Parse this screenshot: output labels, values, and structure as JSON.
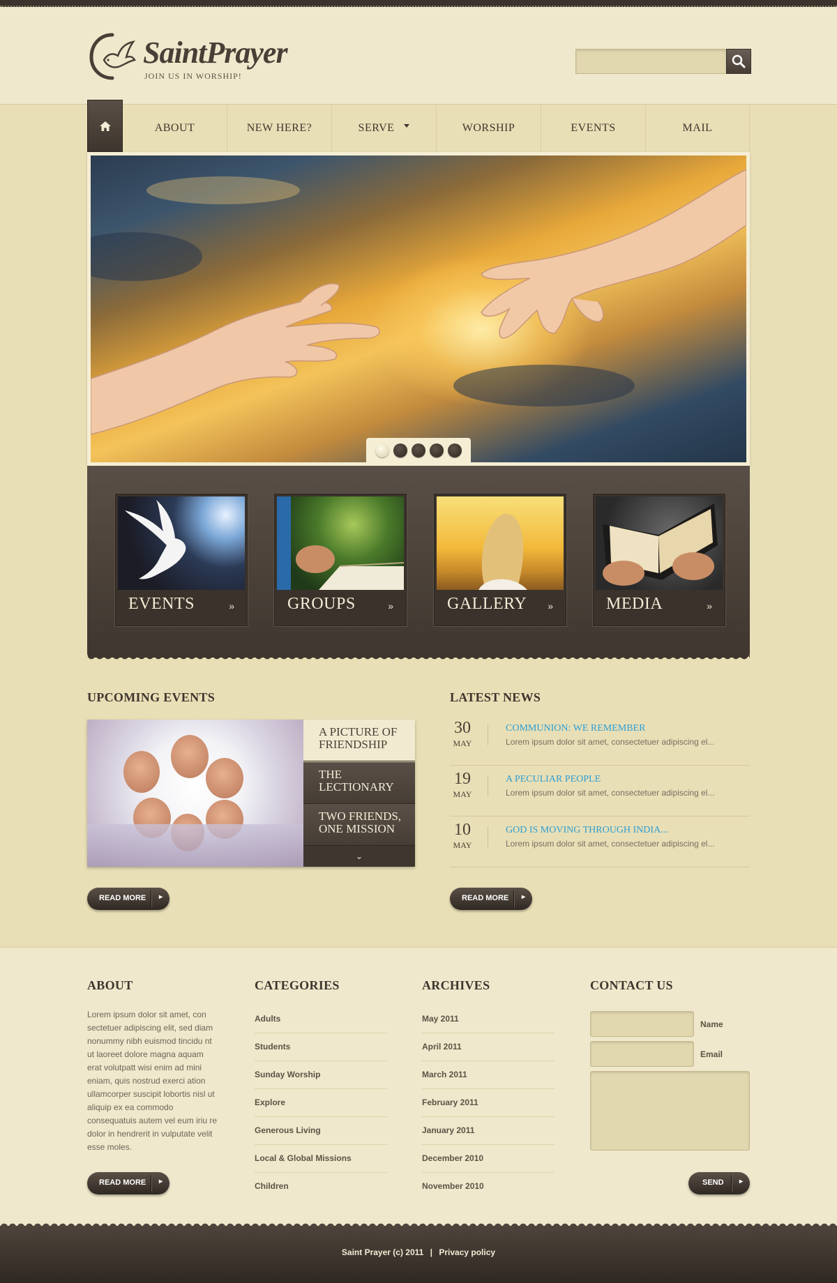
{
  "brand": {
    "name": "SaintPrayer",
    "tagline": "JOIN US IN WORSHIP!"
  },
  "search": {
    "value": "",
    "icon": "search-icon"
  },
  "nav": {
    "home_icon": "home-icon",
    "items": [
      {
        "label": "ABOUT"
      },
      {
        "label": "NEW HERE?"
      },
      {
        "label": "SERVE",
        "has_dropdown": true
      },
      {
        "label": "WORSHIP"
      },
      {
        "label": "EVENTS"
      },
      {
        "label": "MAIL"
      }
    ]
  },
  "slider": {
    "slide_count": 5,
    "active_index": 0
  },
  "features": [
    {
      "label": "EVENTS"
    },
    {
      "label": "GROUPS"
    },
    {
      "label": "GALLERY"
    },
    {
      "label": "MEDIA"
    }
  ],
  "upcoming": {
    "title": "UPCOMING EVENTS",
    "items": [
      {
        "title": "A PICTURE OF FRIENDSHIP",
        "line1": "A PICTURE OF",
        "line2": "FRIENDSHIP"
      },
      {
        "title": "THE LECTIONARY",
        "line1": "THE",
        "line2": "LECTIONARY"
      },
      {
        "title": "TWO FRIENDS, ONE MISSION",
        "line1": "TWO FRIENDS,",
        "line2": "ONE MISSION"
      }
    ],
    "read_more": "READ MORE"
  },
  "news": {
    "title": "LATEST NEWS",
    "items": [
      {
        "day": "30",
        "month": "MAY",
        "title": "COMMUNION: WE REMEMBER",
        "excerpt": "Lorem ipsum dolor sit amet, consectetuer adipiscing el..."
      },
      {
        "day": "19",
        "month": "MAY",
        "title": "A PECULIAR PEOPLE",
        "excerpt": "Lorem ipsum dolor sit amet, consectetuer adipiscing el..."
      },
      {
        "day": "10",
        "month": "MAY",
        "title": "GOD IS MOVING THROUGH INDIA...",
        "excerpt": "Lorem ipsum dolor sit amet, consectetuer adipiscing el..."
      }
    ],
    "read_more": "READ MORE"
  },
  "footer": {
    "about": {
      "title": "ABOUT",
      "text": "Lorem ipsum dolor sit amet, con sectetuer adipiscing elit, sed diam nonummy nibh euismod tincidu nt ut laoreet dolore magna aquam erat volutpatt wisi enim ad mini eniam, quis nostrud exerci ation ullamcorper suscipit lobortis nisl ut aliquip ex ea commodo consequatuis autem vel eum iriu re dolor in hendrerit in vulputate  velit esse moles.",
      "read_more": "READ MORE"
    },
    "categories": {
      "title": "CATEGORIES",
      "items": [
        "Adults",
        "Students",
        "Sunday Worship",
        "Explore",
        "Generous Living",
        "Local & Global Missions",
        "Children"
      ]
    },
    "archives": {
      "title": "ARCHIVES",
      "items": [
        "May 2011",
        "April 2011",
        "March 2011",
        "February 2011",
        "January 2011",
        "December 2010",
        "November 2010"
      ]
    },
    "contact": {
      "title": "CONTACT US",
      "name_label": "Name",
      "email_label": "Email",
      "name_value": "",
      "email_value": "",
      "message_value": "",
      "send": "SEND"
    }
  },
  "bottom": {
    "copyright": "Saint Prayer (c) 2011",
    "separator": "|",
    "privacy": "Privacy policy"
  },
  "colors": {
    "background": "#e8dfb6",
    "dark_brown": "#3f362f",
    "link_blue": "#2f9ed3"
  }
}
